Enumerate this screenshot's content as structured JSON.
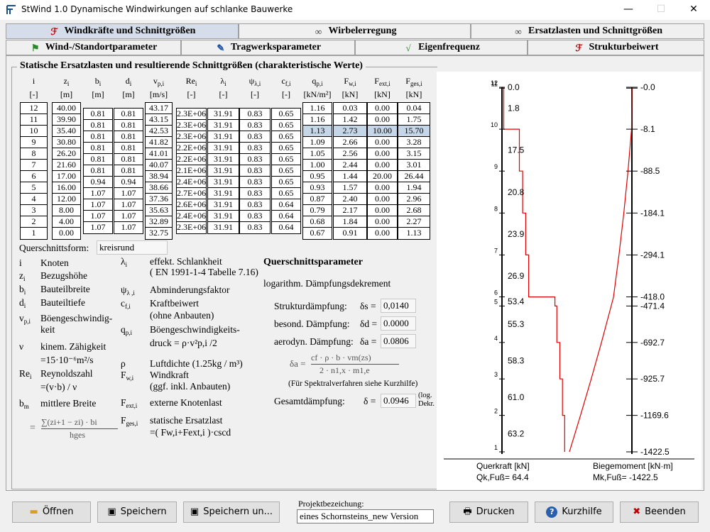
{
  "window": {
    "title": "StWind 1.0   Dynamische Windwirkungen auf schlanke Bauwerke",
    "min": "—",
    "max": "☐",
    "close": "✕"
  },
  "tabs_row1": [
    {
      "label": "Windkräfte und Schnittgrößen",
      "icon": "wind-force-icon",
      "color": "#c00000",
      "active": true
    },
    {
      "label": "Wirbelerregung",
      "icon": "vortex-icon",
      "color": "#333",
      "active": false
    },
    {
      "label": "Ersatzlasten und Schnittgrößen",
      "icon": "vortex-icon",
      "color": "#333",
      "active": false
    }
  ],
  "tabs_row2": [
    {
      "label": "Wind-/Standortparameter",
      "icon": "flag-icon",
      "color": "#2a8a2a"
    },
    {
      "label": "Tragwerksparameter",
      "icon": "edit-icon",
      "color": "#1b4fa0"
    },
    {
      "label": "Eigenfrequenz",
      "icon": "frequency-icon",
      "color": "#2a8a2a"
    },
    {
      "label": "Strukturbeiwert",
      "icon": "wind-force-icon",
      "color": "#c00000"
    }
  ],
  "section_title": "Statische Ersatzlasten und resultierende Schnittgrößen (charakteristische Werte)",
  "headers": [
    {
      "sym": "i",
      "sub": "",
      "unit": "[-]"
    },
    {
      "sym": "z",
      "sub": "i",
      "unit": "[m]"
    },
    {
      "sym": "b",
      "sub": "i",
      "unit": "[m]"
    },
    {
      "sym": "d",
      "sub": "i",
      "unit": "[m]"
    },
    {
      "sym": "v",
      "sub": "p,i",
      "unit": "[m/s]"
    },
    {
      "sym": "Re",
      "sub": "i",
      "unit": "[-]"
    },
    {
      "sym": "λ",
      "sub": "i",
      "unit": "[-]"
    },
    {
      "sym": "ψ",
      "sub": "λ,i",
      "unit": "[-]"
    },
    {
      "sym": "c",
      "sub": "f,i",
      "unit": "[-]"
    },
    {
      "sym": "q",
      "sub": "p,i",
      "unit": "[kN/m²]"
    },
    {
      "sym": "F",
      "sub": "w,i",
      "unit": "[kN]"
    },
    {
      "sym": "F",
      "sub": "ext,i",
      "unit": "[kN]"
    },
    {
      "sym": "F",
      "sub": "ges,i",
      "unit": "[kN]"
    }
  ],
  "cols": {
    "i": [
      "12",
      "11",
      "10",
      "9",
      "8",
      "7",
      "6",
      "5",
      "4",
      "3",
      "2",
      "1"
    ],
    "z": [
      "40.00",
      "39.90",
      "35.40",
      "30.80",
      "26.20",
      "21.60",
      "17.00",
      "16.00",
      "12.00",
      "8.00",
      "4.00",
      "0.00"
    ],
    "b": [
      "0.81",
      "0.81",
      "0.81",
      "0.81",
      "0.81",
      "0.81",
      "0.94",
      "1.07",
      "1.07",
      "1.07",
      "1.07"
    ],
    "d": [
      "0.81",
      "0.81",
      "0.81",
      "0.81",
      "0.81",
      "0.81",
      "0.94",
      "1.07",
      "1.07",
      "1.07",
      "1.07"
    ],
    "v": [
      "43.17",
      "43.15",
      "42.53",
      "41.82",
      "41.01",
      "40.07",
      "38.94",
      "38.66",
      "37.36",
      "35.63",
      "32.89",
      "32.75"
    ],
    "re": [
      "2.3E+06",
      "2.3E+06",
      "2.3E+06",
      "2.2E+06",
      "2.2E+06",
      "2.1E+06",
      "2.4E+06",
      "2.7E+06",
      "2.6E+06",
      "2.4E+06",
      "2.3E+06"
    ],
    "lam": [
      "31.91",
      "31.91",
      "31.91",
      "31.91",
      "31.91",
      "31.91",
      "31.91",
      "31.91",
      "31.91",
      "31.91",
      "31.91"
    ],
    "psi": [
      "0.83",
      "0.83",
      "0.83",
      "0.83",
      "0.83",
      "0.83",
      "0.83",
      "0.83",
      "0.83",
      "0.83",
      "0.83"
    ],
    "cf": [
      "0.65",
      "0.65",
      "0.65",
      "0.65",
      "0.65",
      "0.65",
      "0.65",
      "0.65",
      "0.64",
      "0.64",
      "0.64"
    ],
    "q": [
      "1.16",
      "1.16",
      "1.13",
      "1.09",
      "1.05",
      "1.00",
      "0.95",
      "0.93",
      "0.87",
      "0.79",
      "0.68",
      "0.67"
    ],
    "fw": [
      "0.03",
      "1.42",
      "2.73",
      "2.66",
      "2.56",
      "2.44",
      "1.44",
      "1.57",
      "2.40",
      "2.17",
      "1.84",
      "0.91"
    ],
    "fext": [
      "0.00",
      "0.00",
      "10.00",
      "0.00",
      "0.00",
      "0.00",
      "20.00",
      "0.00",
      "0.00",
      "0.00",
      "0.00",
      "0.00"
    ],
    "fges": [
      "0.04",
      "1.75",
      "15.70",
      "3.28",
      "3.15",
      "3.01",
      "26.44",
      "1.94",
      "2.96",
      "2.68",
      "2.27",
      "1.13"
    ]
  },
  "querschnitt": {
    "label": "Querschnittsform:",
    "value": "kreisrund"
  },
  "legend_left": [
    {
      "sym": "i",
      "sub": "",
      "text": "Knoten"
    },
    {
      "sym": "z",
      "sub": "i",
      "text": "Bezugshöhe"
    },
    {
      "sym": "b",
      "sub": "i",
      "text": "Bauteilbreite"
    },
    {
      "sym": "d",
      "sub": "i",
      "text": "Bauteiltiefe"
    },
    {
      "sym": "v",
      "sub": "p,i",
      "text": "Böengeschwindig-"
    },
    {
      "sym": "",
      "sub": "",
      "text": "keit"
    },
    {
      "sym": "ν",
      "sub": "",
      "text": "kinem. Zähigkeit"
    },
    {
      "sym": "",
      "sub": "",
      "text": "=15·10⁻⁶m²/s"
    },
    {
      "sym": "Re",
      "sub": "i",
      "text": "Reynoldszahl"
    },
    {
      "sym": "",
      "sub": "",
      "text": "=(v·b) / ν"
    },
    {
      "sym": "b",
      "sub": "m",
      "text": "mittlere Breite"
    }
  ],
  "legend_mid": [
    {
      "sym": "λ",
      "sub": "i",
      "text": "effekt. Schlankheit"
    },
    {
      "sym": "",
      "sub": "",
      "text": "( EN 1991-1-4 Tabelle 7.16)"
    },
    {
      "sym": "ψ",
      "sub": "λ ,i",
      "text": "Abminderungsfaktor"
    },
    {
      "sym": "c",
      "sub": "f,i",
      "text": "Kraftbeiwert"
    },
    {
      "sym": "",
      "sub": "",
      "text": "(ohne Anbauten)"
    },
    {
      "sym": "q",
      "sub": "p,i",
      "text": "Böengeschwindigkeits-"
    },
    {
      "sym": "",
      "sub": "",
      "text": "druck = ρ·v²p,i /2"
    },
    {
      "sym": "ρ",
      "sub": "",
      "text": "Luftdichte (1.25kg / m³)"
    },
    {
      "sym": "F",
      "sub": "w,i",
      "text": "Windkraft"
    },
    {
      "sym": "",
      "sub": "",
      "text": "(ggf. inkl. Anbauten)"
    },
    {
      "sym": "F",
      "sub": "ext,i",
      "text": "externe Knotenlast"
    },
    {
      "sym": "F",
      "sub": "ges,i",
      "text": "statische Ersatzlast"
    },
    {
      "sym": "",
      "sub": "",
      "text": "=( Fw,i+Fext,i )·cscd"
    }
  ],
  "bm_formula": {
    "eq": "=",
    "num": "∑(zi+1 − zi) · bi",
    "den": "hges"
  },
  "qparam": {
    "title": "Querschnittsparameter",
    "sub": "logarithm. Dämpfungsdekrement",
    "rows": [
      {
        "label": "Strukturdämpfung:",
        "sym": "δs =",
        "value": "0,0140"
      },
      {
        "label": "besond. Dämpfung:",
        "sym": "δd =",
        "value": "0.0000"
      },
      {
        "label": "aerodyn. Dämpfung:",
        "sym": "δa =",
        "value": "0.0806"
      }
    ],
    "formula_lhs": "δa =",
    "formula_num": "cf · ρ · b · vm(zs)",
    "formula_den": "2 · n1,x · m1,e",
    "note": "(Für Spektralverfahren siehe Kurzhilfe)",
    "total_label": "Gesamtdämpfung:",
    "total_sym": "δ =",
    "total_value": "0.0946",
    "total_unit1": "(log.",
    "total_unit2": "Dekr."
  },
  "chart_data": {
    "type": "line",
    "nodes": [
      1,
      2,
      3,
      4,
      5,
      6,
      7,
      8,
      9,
      10,
      11,
      12
    ],
    "node_heights_m": [
      0.0,
      4.0,
      8.0,
      12.0,
      16.0,
      17.0,
      21.6,
      26.2,
      30.8,
      35.4,
      39.9,
      40.0
    ],
    "shear_labels": [
      "0.0",
      "1.8",
      "17.5",
      "20.8",
      "23.9",
      "26.9",
      "53.4",
      "55.3",
      "58.3",
      "61.0",
      "63.2"
    ],
    "shear_segments_kN": [
      {
        "from": 39.9,
        "to": 40.0,
        "v": 0.04
      },
      {
        "from": 35.4,
        "to": 39.9,
        "v": 1.8
      },
      {
        "from": 30.8,
        "to": 35.4,
        "v": 17.5
      },
      {
        "from": 26.2,
        "to": 30.8,
        "v": 20.8
      },
      {
        "from": 21.6,
        "to": 26.2,
        "v": 23.9
      },
      {
        "from": 17.0,
        "to": 21.6,
        "v": 26.9
      },
      {
        "from": 16.0,
        "to": 17.0,
        "v": 53.4
      },
      {
        "from": 12.0,
        "to": 16.0,
        "v": 55.3
      },
      {
        "from": 8.0,
        "to": 12.0,
        "v": 58.3
      },
      {
        "from": 4.0,
        "to": 8.0,
        "v": 61.0
      },
      {
        "from": 0.0,
        "to": 4.0,
        "v": 63.2
      }
    ],
    "moment_labels": [
      "-0.0",
      "-8.1",
      "-88.5",
      "-184.1",
      "-294.1",
      "-418.0",
      "-471.4",
      "-692.7",
      "-925.7",
      "-1169.6",
      "-1422.5"
    ],
    "moment_values": [
      -1422.5,
      -1169.6,
      -925.7,
      -692.7,
      -471.4,
      -418.0,
      -294.1,
      -184.1,
      -88.5,
      -8.1,
      -0.0,
      -0.0
    ],
    "shear_axis_label": "Querkraft [kN]",
    "shear_foot": "Qk,Fuß= 64.4",
    "moment_axis_label": "Biegemoment [kN·m]",
    "moment_foot": "Mk,Fuß= -1422.5",
    "line_color": "#e00000"
  },
  "buttons": {
    "open": "Öffnen",
    "save": "Speichern",
    "save_as": "Speichern un...",
    "print": "Drucken",
    "help": "Kurzhilfe",
    "exit": "Beenden"
  },
  "project": {
    "label": "Projektbezeichung:",
    "value": "eines Schornsteins_new Version"
  }
}
